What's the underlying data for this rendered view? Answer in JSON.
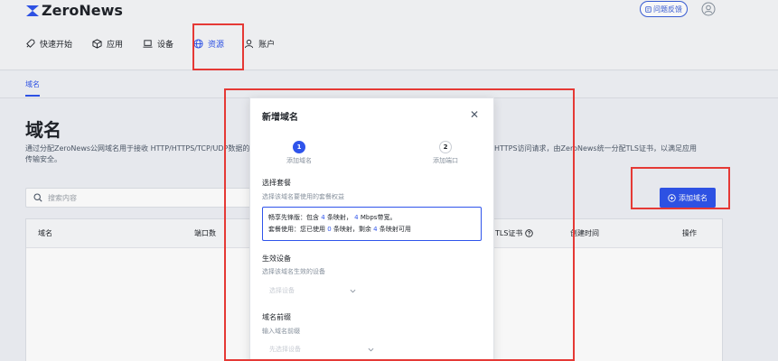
{
  "app": {
    "logo_text": "ZeroNews",
    "help_label": "问题反馈"
  },
  "nav": [
    {
      "label": "快速开始",
      "icon": "rocket-icon"
    },
    {
      "label": "应用",
      "icon": "cube-icon"
    },
    {
      "label": "设备",
      "icon": "laptop-icon"
    },
    {
      "label": "资源",
      "icon": "globe-icon",
      "active": true
    },
    {
      "label": "账户",
      "icon": "user-icon"
    }
  ],
  "subnav": {
    "tab": "域名"
  },
  "page": {
    "title": "域名",
    "desc_left": "通过分配ZeroNews公网域名用于接收 HTTP/HTTPS/TCP/UDP数据的传输安全。",
    "desc_right": "HTTPS访问请求，由ZeroNews统一分配TLS证书，以满足应用",
    "search_placeholder": "搜索内容",
    "add_button": "添加域名"
  },
  "table": {
    "headers": [
      "域名",
      "端口数",
      "TLS证书",
      "创建时间",
      "操作"
    ]
  },
  "modal": {
    "title": "新增域名",
    "steps": [
      {
        "num": "1",
        "label": "添加域名"
      },
      {
        "num": "2",
        "label": "添加端口"
      }
    ],
    "package_section": {
      "label": "选择套餐",
      "hint": "选择该域名要使用的套餐权益",
      "line1_prefix": "畅享先锋版：包含",
      "line1_count": "4",
      "line1_mid": "条映射，",
      "line1_bw": "4",
      "line1_suffix": "Mbps带宽。",
      "line2_prefix": "套餐使用：您已使用",
      "line2_used": "0",
      "line2_mid": "条映射，剩余",
      "line2_left": "4",
      "line2_suffix": "条映射可用"
    },
    "device_section": {
      "label": "生效设备",
      "hint": "选择该域名生效的设备",
      "placeholder": "选择设备"
    },
    "prefix_section": {
      "label": "域名前缀",
      "hint": "输入域名前缀",
      "placeholder": "先选择设备"
    }
  },
  "colors": {
    "accent": "#2f54eb",
    "annotation": "#e53935"
  }
}
